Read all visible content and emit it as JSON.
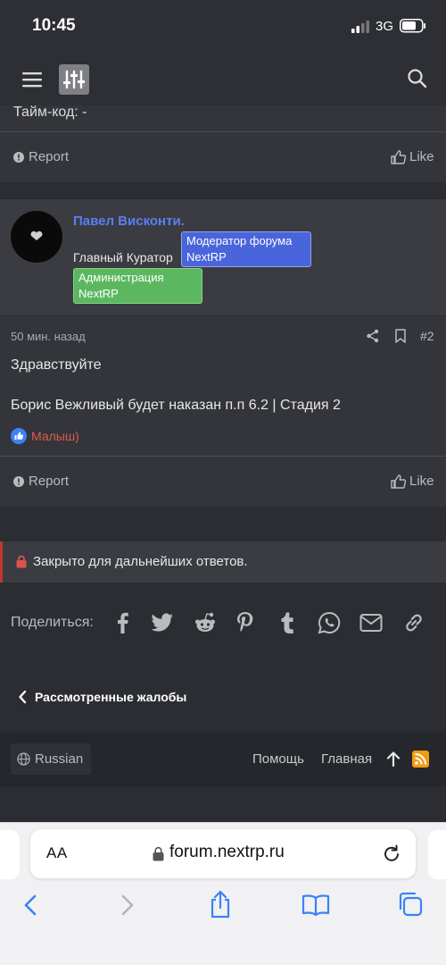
{
  "status": {
    "time": "10:45",
    "network": "3G"
  },
  "post1": {
    "timecode_text": "Тайм-код: -",
    "report_label": "Report",
    "like_label": "Like"
  },
  "post2": {
    "username": "Павел Висконти.",
    "title": "Главный Куратор",
    "banner_moderator": {
      "line1": "Модератор форума",
      "line2": "NextRP",
      "color": "#4a64db"
    },
    "banner_admin": {
      "line1": "Администрация",
      "line2": "NextRP",
      "color": "#5cb860"
    },
    "time": "50 мин. назад",
    "post_number": "#2",
    "greeting": "Здравствуйте",
    "text": "Борис Вежливый будет наказан п.п 6.2 | Стадия 2",
    "reaction_user": "Малыш)",
    "report_label": "Report",
    "like_label": "Like"
  },
  "closed_notice": "Закрыто для дальнейших ответов.",
  "share": {
    "label": "Поделиться:",
    "icons": [
      "facebook-icon",
      "twitter-icon",
      "reddit-icon",
      "pinterest-icon",
      "tumblr-icon",
      "whatsapp-icon",
      "email-icon",
      "link-icon"
    ]
  },
  "back_link": "Рассмотренные жалобы",
  "footer": {
    "language": "Russian",
    "help": "Помощь",
    "home": "Главная"
  },
  "browser": {
    "aa": "AA",
    "url": "forum.nextrp.ru"
  },
  "colors": {
    "username": "#5b7ef0",
    "reaction": "#e05a4e",
    "accent_red": "#c0392b",
    "link_blue": "#3b82f6",
    "rss": "#f39c12"
  }
}
